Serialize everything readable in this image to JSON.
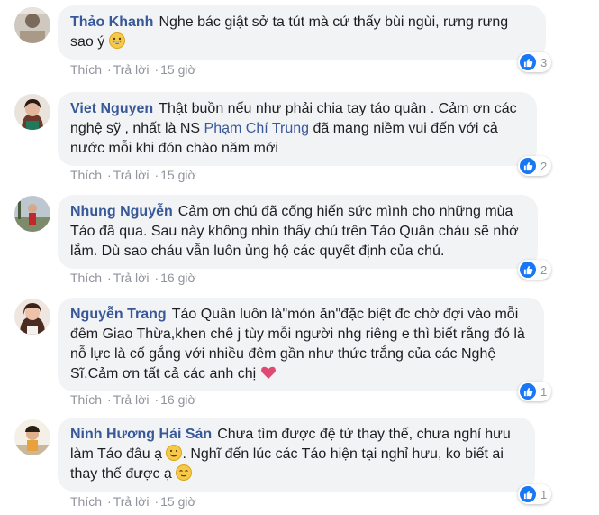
{
  "comments": [
    {
      "author": "Thảo Khanh",
      "text": "Nghe bác giật sở ta tút mà cứ thấy bùi ngùi, rưng rưng sao ý",
      "emoji": "grinning-face-icon",
      "like": "Thích",
      "reply": "Trả lời",
      "time": "15 giờ",
      "reactions": "3"
    },
    {
      "author": "Viet Nguyen",
      "text_before_link": "Thật buồn nếu như phải chia tay táo quân . Cảm ơn các nghệ sỹ , nhất là NS ",
      "link": "Phạm Chí Trung",
      "text_after_link": " đã mang niềm vui đến với cả nước mỗi khi đón chào năm mới",
      "like": "Thích",
      "reply": "Trả lời",
      "time": "15 giờ",
      "reactions": "2"
    },
    {
      "author": "Nhung Nguyễn",
      "text": "Cảm ơn chú đã cống hiến sức mình cho những mùa Táo đã qua. Sau này không nhìn thấy chú trên Táo Quân cháu sẽ nhớ lắm. Dù sao cháu vẫn luôn ủng hộ các quyết định của chú.",
      "like": "Thích",
      "reply": "Trả lời",
      "time": "16 giờ",
      "reactions": "2"
    },
    {
      "author": "Nguyễn Trang",
      "text": "Táo Quân luôn là\"món ăn\"đặc biệt đc chờ đợi vào mỗi đêm Giao Thừa,khen chê j tùy mỗi người nhg riêng e thì biết rằng đó là nỗ lực là cố gắng với nhiều đêm gần như thức trắng của các Nghệ Sĩ.Cảm ơn tất cả các anh chị",
      "emoji": "heart-icon",
      "like": "Thích",
      "reply": "Trả lời",
      "time": "16 giờ",
      "reactions": "1"
    },
    {
      "author": "Ninh Hương Hải Sản",
      "text_part1": "Chưa tìm được đệ tử thay thế, chưa nghỉ hưu làm Táo đâu ạ",
      "text_part2": ". Nghĩ đến lúc các Táo hiện tại nghỉ hưu, ko biết ai thay thế được ạ",
      "emoji1": "smiling-face-icon",
      "emoji2": "relieved-face-icon",
      "like": "Thích",
      "reply": "Trả lời",
      "time": "15 giờ",
      "reactions": "1"
    }
  ],
  "colors": {
    "author": "#385898",
    "bubble": "#f2f3f5",
    "meta": "#90949c",
    "like_badge": "#1877f2"
  }
}
